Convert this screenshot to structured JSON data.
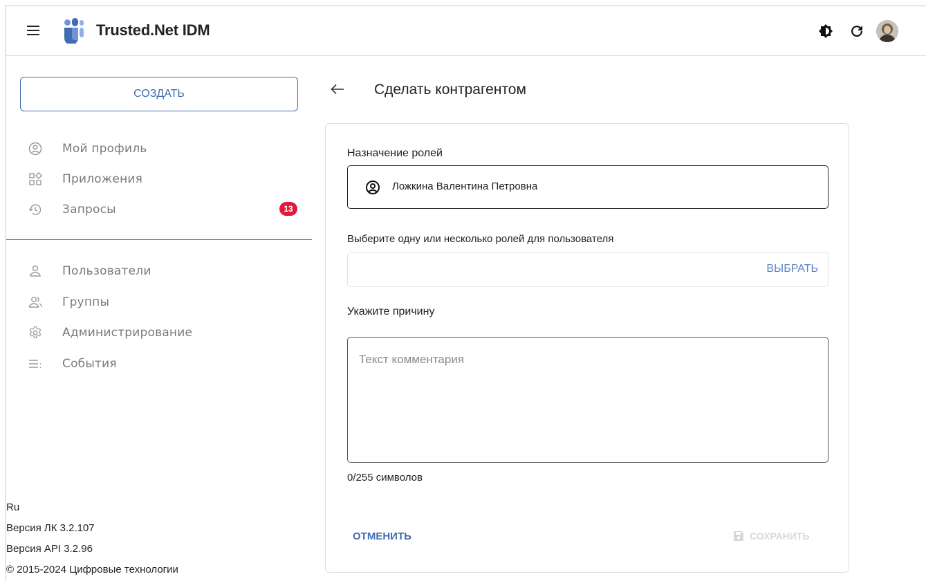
{
  "header": {
    "app_title": "Trusted.Net IDM",
    "icons": [
      "menu-icon",
      "brightness-icon",
      "refresh-icon",
      "user-avatar"
    ]
  },
  "sidebar": {
    "create_label": "СОЗДАТЬ",
    "items": [
      {
        "label": "Мой профиль",
        "icon": "account-circle-icon"
      },
      {
        "label": "Приложения",
        "icon": "apps-icon"
      },
      {
        "label": "Запросы",
        "icon": "history-icon",
        "badge": "13"
      },
      {
        "label": "Пользователи",
        "icon": "person-icon"
      },
      {
        "label": "Группы",
        "icon": "group-icon"
      },
      {
        "label": "Администрирование",
        "icon": "settings-icon"
      },
      {
        "label": "События",
        "icon": "event-list-icon"
      }
    ],
    "footer": {
      "language": "Ru",
      "lk_version": "Версия ЛК 3.2.107",
      "api_version": "Версия API 3.2.96",
      "copyright": "© 2015-2024 Цифровые технологии"
    }
  },
  "main": {
    "title": "Сделать контрагентом",
    "roles_assignment_label": "Назначение ролей",
    "user_name": "Ложкина Валентина Петровна",
    "roles_select_label": "Выберите одну или несколько ролей для пользователя",
    "select_button": "ВЫБРАТЬ",
    "reason_label": "Укажите причину",
    "comment_placeholder": "Текст комментария",
    "counter": "0/255 символов",
    "cancel_button": "ОТМЕНИТЬ",
    "save_button": "СОХРАНИТЬ"
  },
  "colors": {
    "accent": "#3f6db3",
    "badge": "#e01a3c",
    "logo": "#3f6db3"
  }
}
